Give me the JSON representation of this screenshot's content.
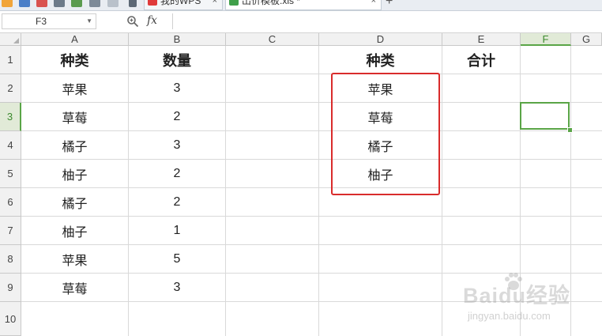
{
  "toolbar": {
    "tabs": [
      {
        "label": "我的WPS",
        "icon": "wps-logo-icon"
      },
      {
        "label": "出价模板.xls *",
        "icon": "spreadsheet-file-icon"
      }
    ],
    "close_symbol": "×",
    "new_tab_symbol": "+"
  },
  "formula_bar": {
    "name_box": "F3",
    "fx_label": "fx",
    "formula": ""
  },
  "sheet": {
    "columns": [
      "A",
      "B",
      "C",
      "D",
      "E",
      "F",
      "G"
    ],
    "active_column": "F",
    "rows": [
      "1",
      "2",
      "3",
      "4",
      "5",
      "6",
      "7",
      "8",
      "9",
      "10"
    ],
    "active_row": "3",
    "selected_cell": "F3",
    "data_table": {
      "headers": [
        "种类",
        "数量"
      ],
      "rows": [
        [
          "苹果",
          "3"
        ],
        [
          "草莓",
          "2"
        ],
        [
          "橘子",
          "3"
        ],
        [
          "柚子",
          "2"
        ],
        [
          "橘子",
          "2"
        ],
        [
          "柚子",
          "1"
        ],
        [
          "苹果",
          "5"
        ],
        [
          "草莓",
          "3"
        ]
      ]
    },
    "summary_table": {
      "headers": [
        "种类",
        "合计"
      ],
      "items": [
        "苹果",
        "草莓",
        "橘子",
        "柚子"
      ]
    },
    "highlight_color": "#d92b2b",
    "selection_color": "#5aa547"
  },
  "watermark": {
    "brand": "Baidu经验",
    "url": "jingyan.baidu.com"
  }
}
